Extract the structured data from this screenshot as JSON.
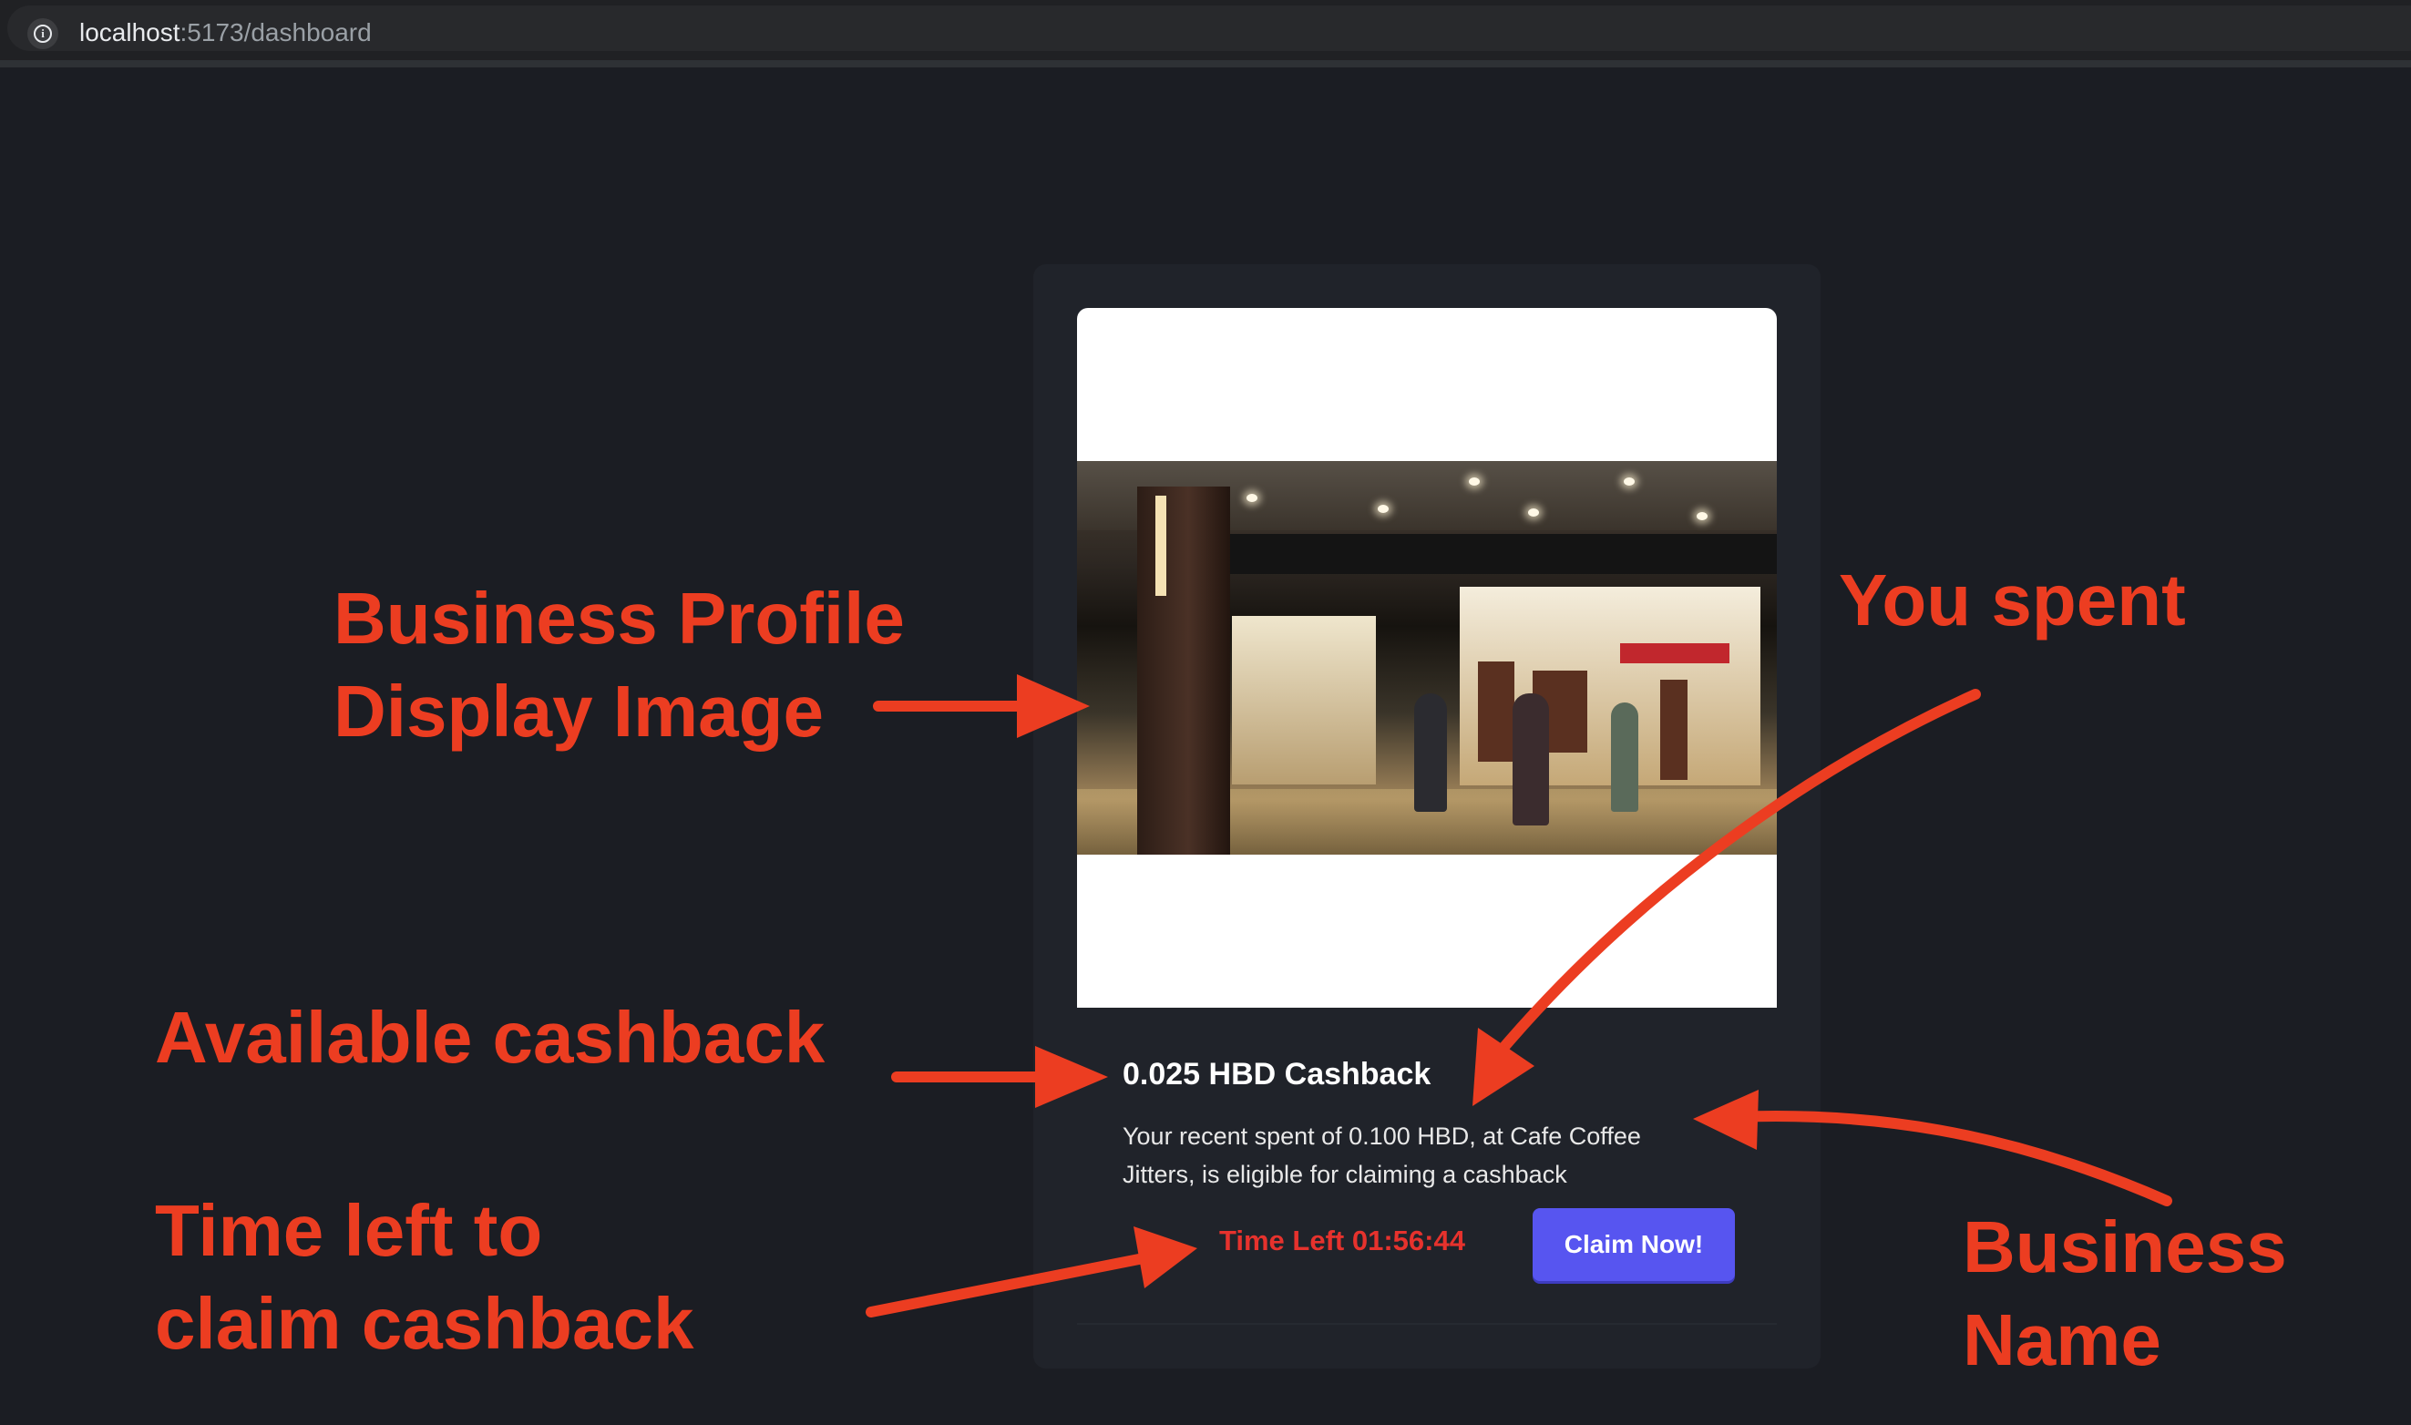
{
  "browser": {
    "url_host": "localhost",
    "url_path": ":5173/dashboard",
    "info_icon": "info-icon"
  },
  "card": {
    "image_icon": "business-profile-image",
    "cashback_title": "0.025 HBD Cashback",
    "description": "Your recent spent of 0.100 HBD, at Cafe Coffee Jitters, is eligible for claiming a cashback",
    "time_left": "Time Left 01:56:44",
    "claim_button": "Claim Now!"
  },
  "annotations": {
    "business_profile_line1": "Business Profile",
    "business_profile_line2": "Display Image",
    "you_spent": "You spent",
    "available_cashback": "Available cashback",
    "time_left_line1": "Time left to",
    "time_left_line2": "claim cashback",
    "business_name_line1": "Business",
    "business_name_line2": "Name"
  },
  "colors": {
    "annotation": "#ec3d21",
    "button": "#5755f0",
    "time_left": "#e6322d",
    "background": "#1b1d23"
  }
}
